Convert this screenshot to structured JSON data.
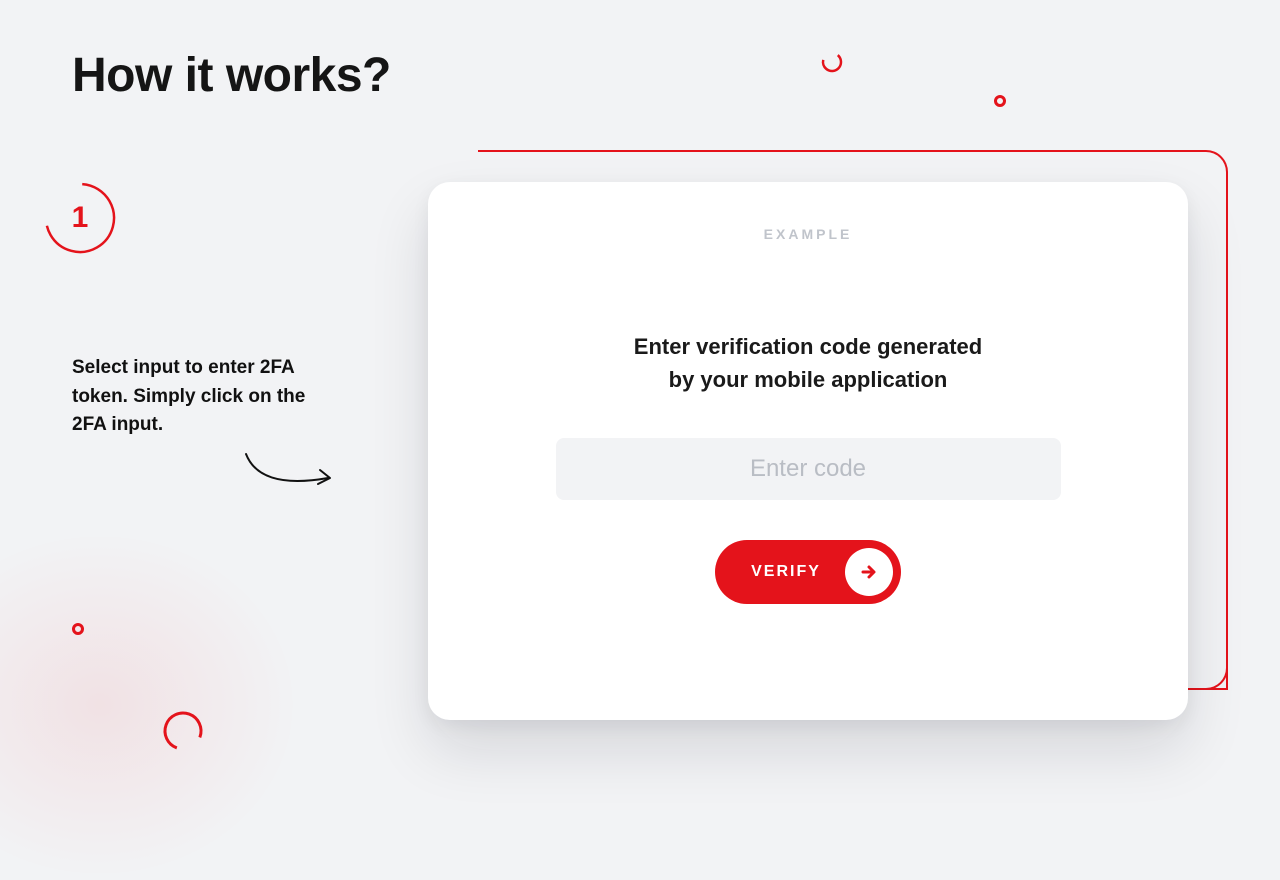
{
  "heading": "How it works?",
  "step": {
    "number": "1",
    "text": "Select input to enter 2FA token. Simply click on the 2FA input."
  },
  "card": {
    "badge": "EXAMPLE",
    "instruction_line1": "Enter verification code generated",
    "instruction_line2": "by your mobile application",
    "input_placeholder": "Enter code",
    "verify_label": "VERIFY"
  },
  "colors": {
    "accent": "#e4131b"
  }
}
